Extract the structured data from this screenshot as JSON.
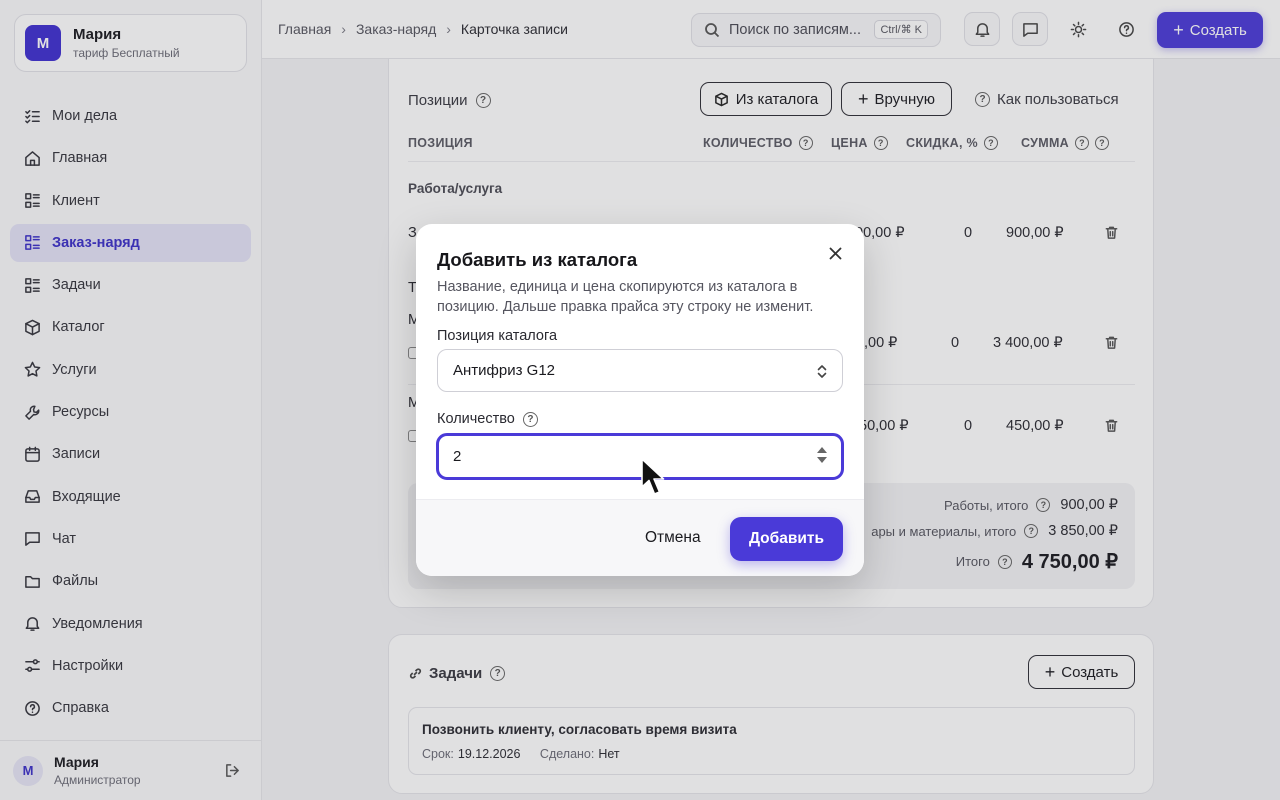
{
  "org": {
    "avatar": "М",
    "name": "Мария",
    "plan": "тариф Бесплатный"
  },
  "nav": [
    {
      "label": "Мои дела",
      "icon": "checklist-icon"
    },
    {
      "label": "Главная",
      "icon": "home-icon"
    },
    {
      "label": "Клиент",
      "icon": "list-icon"
    },
    {
      "label": "Заказ-наряд",
      "icon": "list-icon",
      "active": true
    },
    {
      "label": "Задачи",
      "icon": "list-icon"
    },
    {
      "label": "Каталог",
      "icon": "box-icon"
    },
    {
      "label": "Услуги",
      "icon": "star-icon"
    },
    {
      "label": "Ресурсы",
      "icon": "wrench-icon"
    },
    {
      "label": "Записи",
      "icon": "calendar-icon"
    },
    {
      "label": "Входящие",
      "icon": "inbox-icon"
    },
    {
      "label": "Чат",
      "icon": "chat-icon"
    },
    {
      "label": "Файлы",
      "icon": "folder-icon"
    },
    {
      "label": "Уведомления",
      "icon": "bell-icon"
    },
    {
      "label": "Настройки",
      "icon": "sliders-icon"
    },
    {
      "label": "Справка",
      "icon": "help-icon"
    }
  ],
  "user": {
    "avatar": "М",
    "name": "Мария",
    "role": "Администратор"
  },
  "breadcrumbs": [
    "Главная",
    "Заказ-наряд",
    "Карточка записи"
  ],
  "search": {
    "placeholder": "Поиск по записям...",
    "shortcut": "Ctrl/⌘ K"
  },
  "topbar": {
    "create_label": "Создать"
  },
  "positions": {
    "title": "Позиции",
    "from_catalog": "Из каталога",
    "manual": "Вручную",
    "how_to": "Как пользоваться",
    "columns": {
      "position": "ПОЗИЦИЯ",
      "qty": "КОЛИЧЕСТВО",
      "price": "ЦЕНА",
      "discount": "СКИДКА, %",
      "sum": "СУММА"
    },
    "section_work": "Работа/услуга",
    "row1": {
      "name": "З",
      "price": "00,00 ₽",
      "discount": "0",
      "sum": "900,00 ₽"
    },
    "section_goods": "Т",
    "row2": {
      "name": "М",
      "price": ",00 ₽",
      "discount": "0",
      "sum": "3 400,00 ₽"
    },
    "row3": {
      "name": "М",
      "price": "50,00 ₽",
      "discount": "0",
      "sum": "450,00 ₽"
    },
    "totals": {
      "works_label": "Работы, итого",
      "works_value": "900,00 ₽",
      "goods_label": "ары и материалы, итого",
      "goods_value": "3 850,00 ₽",
      "total_label": "Итого",
      "total_value": "4 750,00 ₽"
    }
  },
  "tasks": {
    "title": "Задачи",
    "create_label": "Создать",
    "item": {
      "name": "Позвонить клиенту, согласовать время визита",
      "due_label": "Срок:",
      "due": "19.12.2026",
      "done_label": "Сделано:",
      "done": "Нет"
    }
  },
  "modal": {
    "title": "Добавить из каталога",
    "description": "Название, единица и цена скопируются из каталога в позицию. Дальше правка прайса эту строку не изменит.",
    "catalog_label": "Позиция каталога",
    "catalog_value": "Антифриз G12",
    "qty_label": "Количество",
    "qty_value": "2",
    "cancel": "Отмена",
    "add": "Добавить"
  },
  "colors": {
    "accent": "#4a3ad8",
    "active_nav_bg": "#e4e3f7"
  }
}
